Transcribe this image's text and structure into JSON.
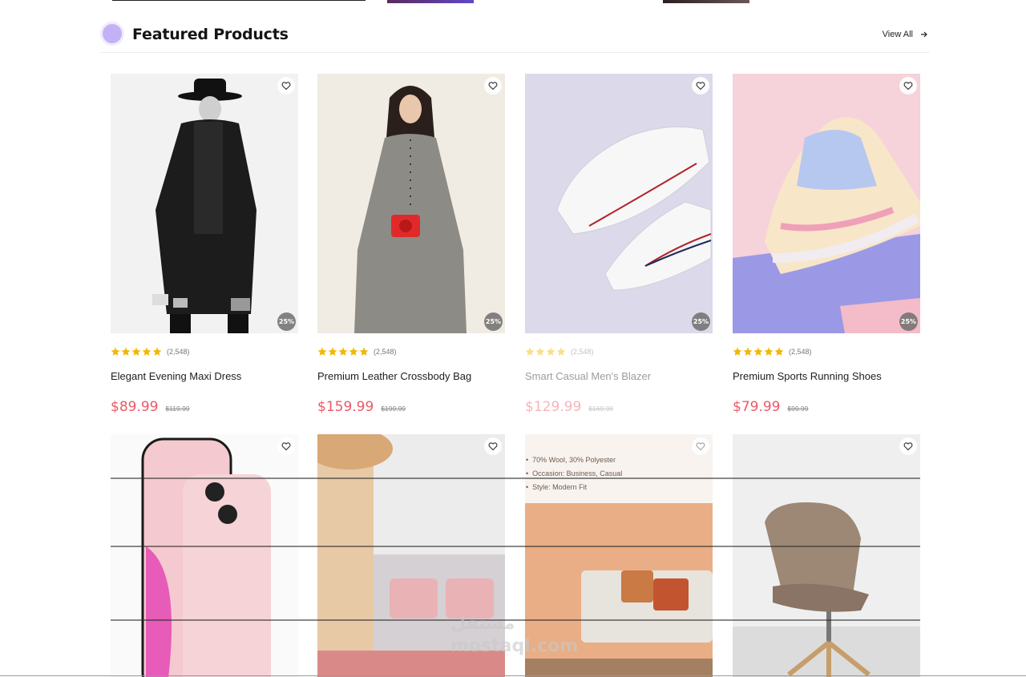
{
  "header": {
    "title": "Featured Products",
    "view_all": "View All"
  },
  "icons": {
    "section_dot": "circle",
    "view_all": "arrow-right-icon",
    "wishlist": "heart-icon",
    "rating": "star-icon"
  },
  "colors": {
    "accent_dot": "#c2b2f5",
    "sale_price": "#e95a67",
    "star": "#f2b705",
    "discount_badge": "#6e6e6e"
  },
  "products": [
    {
      "name": "Elegant Evening Maxi Dress",
      "reviews": "(2,548)",
      "rating": 5,
      "price": "$89.99",
      "old_price": "$119.99",
      "discount": "25%"
    },
    {
      "name": "Premium Leather Crossbody Bag",
      "reviews": "(2,548)",
      "rating": 5,
      "price": "$159.99",
      "old_price": "$199.99",
      "discount": "25%"
    },
    {
      "name": "Smart Casual Men's Blazer",
      "reviews": "(2,548)",
      "rating": 4,
      "price": "$129.99",
      "old_price": "$169.99",
      "discount": "25%"
    },
    {
      "name": "Premium Sports Running Shoes",
      "reviews": "(2,548)",
      "rating": 5,
      "price": "$79.99",
      "old_price": "$99.99",
      "discount": "25%"
    }
  ],
  "overlay": {
    "details": [
      "70% Wool, 30% Polyester",
      "Occasion: Business, Casual",
      "Style: Modern Fit"
    ]
  },
  "watermark": {
    "arabic": "مستقل",
    "latin": "mostaql.com"
  }
}
